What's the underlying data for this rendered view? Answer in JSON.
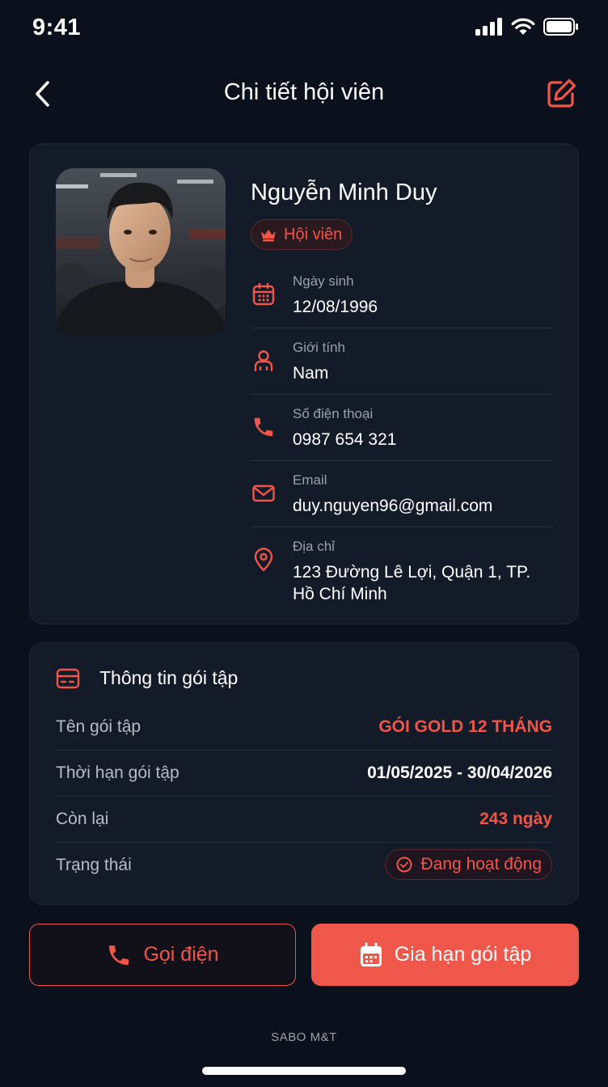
{
  "status_bar": {
    "time": "9:41"
  },
  "header": {
    "title": "Chi tiết hội viên"
  },
  "profile": {
    "name": "Nguyễn Minh Duy",
    "badge": "Hội viên",
    "fields": [
      {
        "label": "Ngày sinh",
        "value": "12/08/1996",
        "icon": "calendar-icon"
      },
      {
        "label": "Giới tính",
        "value": "Nam",
        "icon": "person-icon"
      },
      {
        "label": "Số điện thoại",
        "value": "0987 654 321",
        "icon": "phone-icon"
      },
      {
        "label": "Email",
        "value": "duy.nguyen96@gmail.com",
        "icon": "mail-icon"
      },
      {
        "label": "Địa chỉ",
        "value": "123 Đường Lê Lợi, Quận 1, TP. Hồ Chí Minh",
        "icon": "location-pin-icon"
      }
    ]
  },
  "package": {
    "title": "Thông tin gói tập",
    "rows": [
      {
        "label": "Tên gói tập",
        "value": "GÓI GOLD 12 THÁNG"
      },
      {
        "label": "Thời hạn gói tập",
        "value": "01/05/2025 - 30/04/2026"
      },
      {
        "label": "Còn lại",
        "value": "243 ngày"
      },
      {
        "label": "Trạng thái",
        "value": "Đang hoạt động"
      }
    ]
  },
  "actions": {
    "call_label": "Gọi điện",
    "renew_label": "Gia hạn gói tập"
  },
  "footer": {
    "brand": "SABO M&T"
  },
  "colors": {
    "accent": "#f0554a",
    "background": "#0b111c",
    "card": "#141b28"
  }
}
